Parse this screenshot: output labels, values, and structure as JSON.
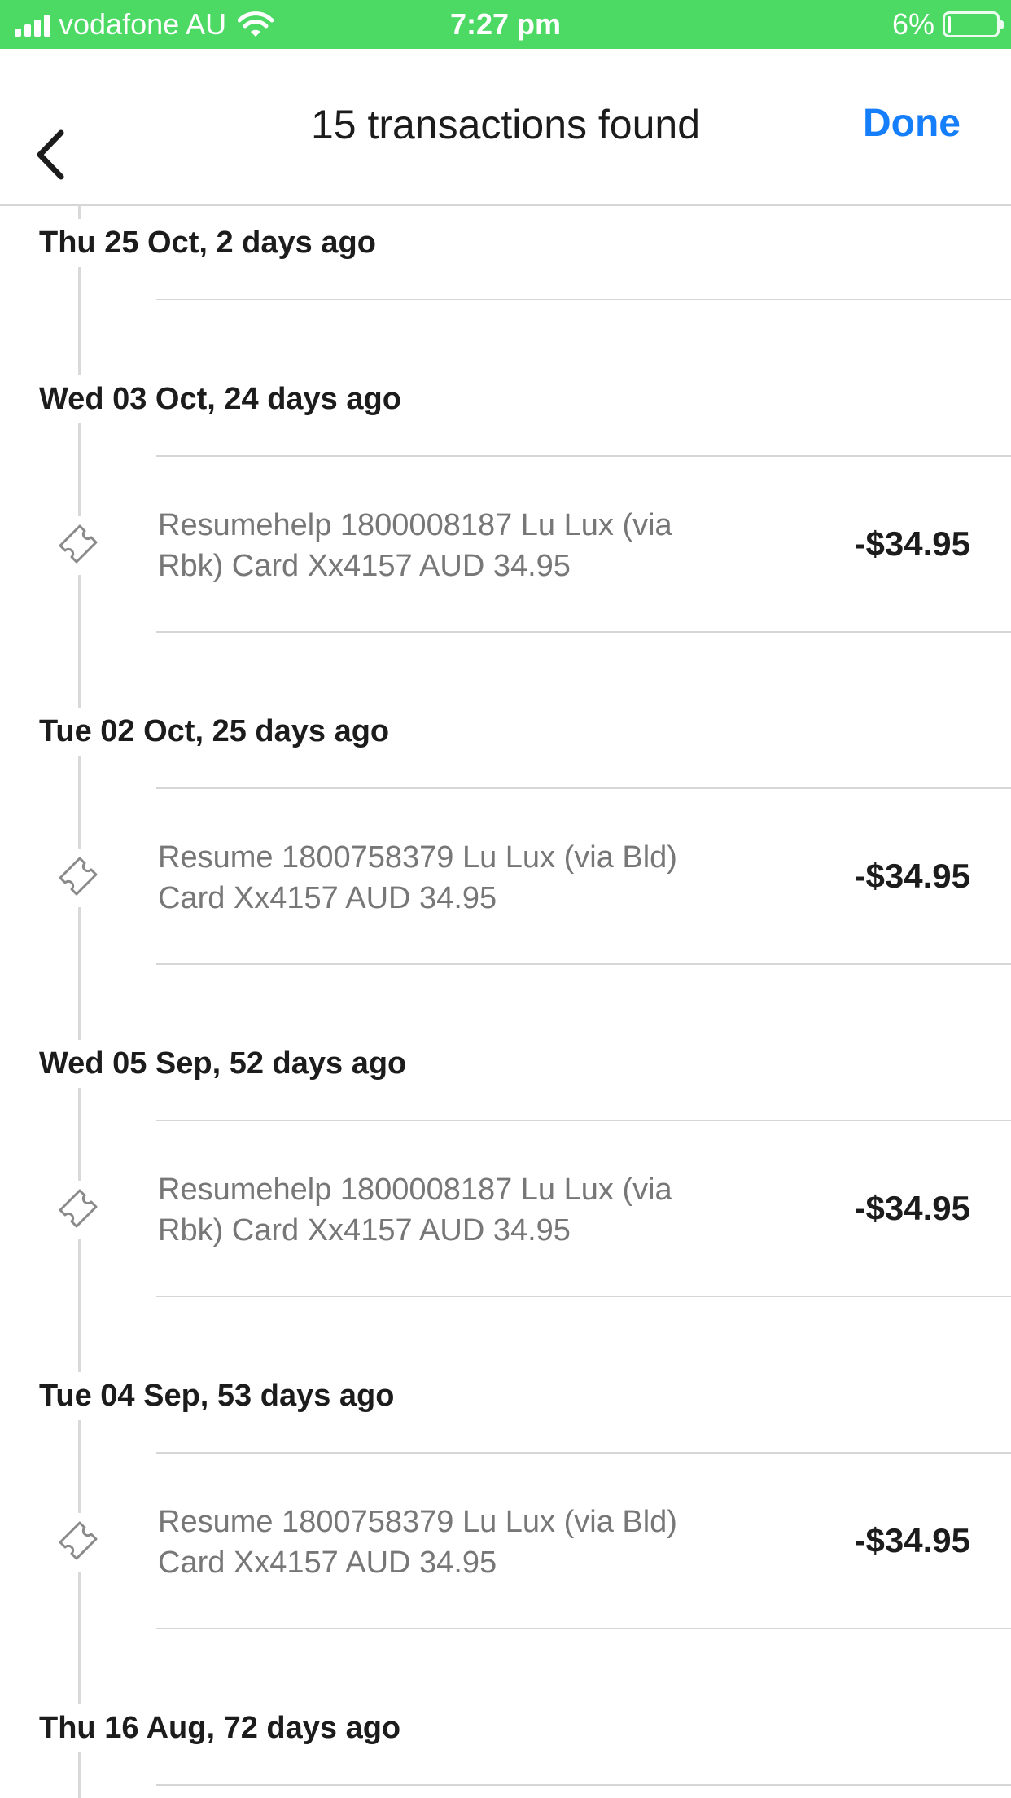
{
  "status_bar": {
    "carrier": "vodafone AU",
    "time": "7:27 pm",
    "battery_percent": "6%",
    "battery_level": 0.06,
    "background_color": "#4cd964",
    "icons": [
      "signal-icon",
      "wifi-icon",
      "battery-icon"
    ]
  },
  "nav": {
    "title": "15 transactions found",
    "done_label": "Done",
    "back_icon": "chevron-left-icon",
    "accent_color": "#147efb"
  },
  "groups": [
    {
      "date": "Thu 25 Oct, 2 days ago",
      "transactions": []
    },
    {
      "date": "Wed 03 Oct, 24 days ago",
      "transactions": [
        {
          "description": "Resumehelp 1800008187 Lu Lux (via Rbk) Card Xx4157 AUD 34.95",
          "amount": "-$34.95",
          "icon": "ticket-icon"
        }
      ]
    },
    {
      "date": "Tue 02 Oct, 25 days ago",
      "transactions": [
        {
          "description": "Resume 1800758379 Lu Lux (via Bld) Card Xx4157 AUD 34.95",
          "amount": "-$34.95",
          "icon": "ticket-icon"
        }
      ]
    },
    {
      "date": "Wed 05 Sep, 52 days ago",
      "transactions": [
        {
          "description": "Resumehelp 1800008187 Lu Lux (via Rbk) Card Xx4157 AUD 34.95",
          "amount": "-$34.95",
          "icon": "ticket-icon"
        }
      ]
    },
    {
      "date": "Tue 04 Sep, 53 days ago",
      "transactions": [
        {
          "description": "Resume 1800758379 Lu Lux (via Bld) Card Xx4157 AUD 34.95",
          "amount": "-$34.95",
          "icon": "ticket-icon"
        }
      ]
    },
    {
      "date": "Thu 16 Aug, 72 days ago",
      "transactions": []
    }
  ]
}
